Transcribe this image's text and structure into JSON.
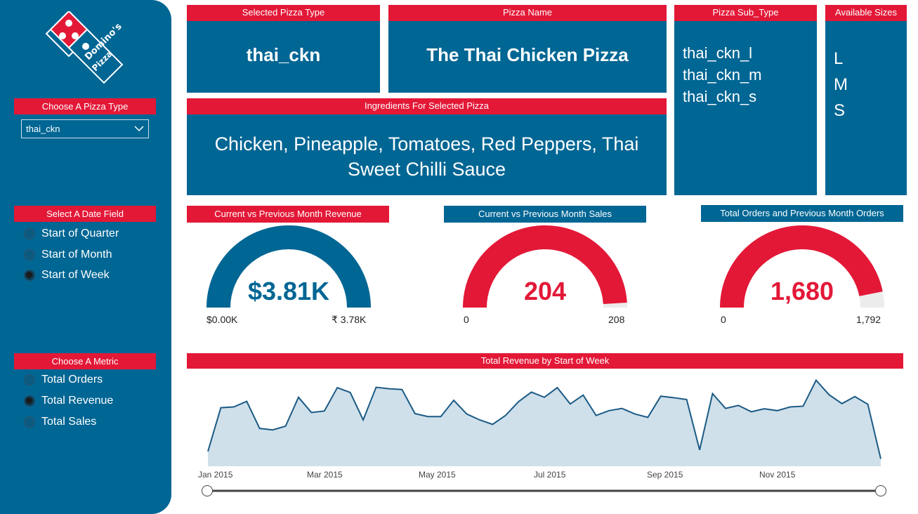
{
  "sidebar": {
    "pizza_type_title": "Choose A Pizza Type",
    "pizza_type_selected": "thai_ckn",
    "date_field_title": "Select A Date Field",
    "date_options": [
      {
        "label": "Start of Quarter",
        "selected": false
      },
      {
        "label": "Start of Month",
        "selected": false
      },
      {
        "label": "Start of Week",
        "selected": true
      }
    ],
    "metric_title": "Choose A Metric",
    "metric_options": [
      {
        "label": "Total Orders",
        "selected": false
      },
      {
        "label": "Total Revenue",
        "selected": true
      },
      {
        "label": "Total Sales",
        "selected": false
      }
    ]
  },
  "cards": {
    "pizza_type": {
      "title": "Selected Pizza Type",
      "value": "thai_ckn"
    },
    "pizza_name": {
      "title": "Pizza Name",
      "value": "The Thai Chicken Pizza"
    },
    "sub_type": {
      "title": "Pizza Sub_Type",
      "items": [
        "thai_ckn_l",
        "thai_ckn_m",
        "thai_ckn_s"
      ]
    },
    "sizes": {
      "title": "Available Sizes",
      "items": [
        "L",
        "M",
        "S"
      ]
    },
    "ingredients": {
      "title": "Ingredients For Selected Pizza",
      "line1": "Chicken, Pineapple, Tomatoes, Red Peppers, Thai",
      "line2": "Sweet Chilli Sauce"
    }
  },
  "gauges": [
    {
      "title": "Current vs Previous Month Revenue",
      "value_label": "$3.81K",
      "min_label": "$0.00K",
      "max_label": "₹ 3.78K",
      "fraction": 1.0,
      "color": "#006694",
      "title_bg": "#e31837"
    },
    {
      "title": "Current vs Previous Month Sales",
      "value_label": "204",
      "min_label": "0",
      "max_label": "208",
      "fraction": 0.981,
      "color": "#e31837",
      "title_bg": "#006694"
    },
    {
      "title": "Total Orders and Previous Month Orders",
      "value_label": "1,680",
      "min_label": "0",
      "max_label": "1,792",
      "fraction": 0.9375,
      "color": "#e31837",
      "title_bg": "#006694"
    }
  ],
  "chart_data": {
    "type": "area",
    "title": "Total Revenue by Start of Week",
    "x_tick_labels": [
      "Jan 2015",
      "Mar 2015",
      "May 2015",
      "Jul 2015",
      "Sep 2015",
      "Nov 2015"
    ],
    "values": [
      190,
      308,
      310,
      325,
      252,
      248,
      258,
      336,
      295,
      299,
      362,
      349,
      275,
      363,
      359,
      357,
      292,
      284,
      284,
      328,
      291,
      275,
      263,
      287,
      324,
      350,
      336,
      362,
      318,
      342,
      287,
      300,
      306,
      291,
      282,
      339,
      335,
      330,
      194,
      346,
      306,
      314,
      297,
      305,
      300,
      310,
      312,
      382,
      343,
      319,
      338,
      317,
      170
    ],
    "ylim": [
      150,
      400
    ],
    "fill": "#cfe0ea",
    "line": "#1b5a85"
  }
}
